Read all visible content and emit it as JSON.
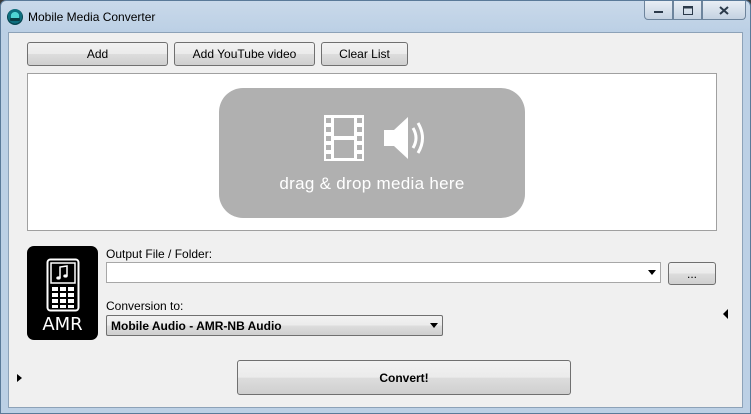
{
  "window": {
    "title": "Mobile Media Converter",
    "controls": {
      "minimize": "−",
      "maximize": "▢",
      "close": "✕"
    }
  },
  "toolbar": {
    "add_label": "Add",
    "add_youtube_label": "Add YouTube video",
    "clear_list_label": "Clear List"
  },
  "drop_area": {
    "text": "drag & drop media here",
    "icons": [
      "film-icon",
      "speaker-icon"
    ]
  },
  "output": {
    "label": "Output File / Folder:",
    "value": "",
    "browse_label": "..."
  },
  "conversion": {
    "label": "Conversion to:",
    "selected": "Mobile Audio - AMR-NB Audio"
  },
  "format_badge": {
    "text": "AMR",
    "icon": "phone-music-icon"
  },
  "convert_label": "Convert!",
  "colors": {
    "drop_card": "#b0b0b0",
    "badge": "#000000",
    "client_bg": "#f0f0f0"
  }
}
